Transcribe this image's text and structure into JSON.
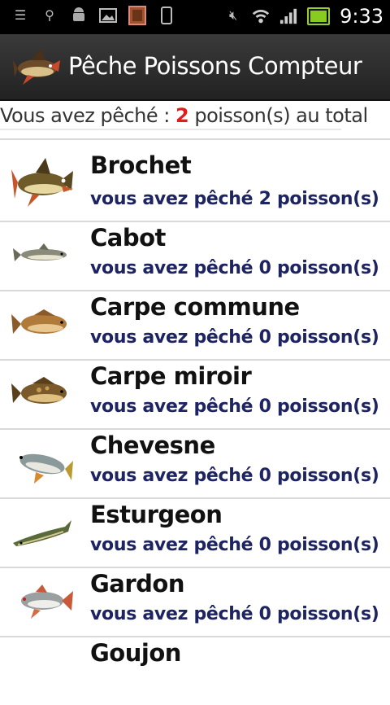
{
  "status_bar": {
    "time": "9:33",
    "icons": [
      "notification-icon",
      "usb-icon",
      "android-icon",
      "image-icon",
      "sd-card-icon",
      "phone-icon",
      "mute-icon",
      "wifi-icon",
      "signal-icon",
      "battery-icon"
    ]
  },
  "app": {
    "title": "Pêche Poissons Compteur",
    "icon": "fish-logo-icon"
  },
  "total": {
    "prefix": "Vous avez pêché : ",
    "count": "2",
    "suffix": " poisson(s) au total"
  },
  "colors": {
    "accent": "#e21b1b",
    "count_text": "#1e2462",
    "actionbar": "#2c2c2c"
  },
  "fish": [
    {
      "name": "Brochet",
      "count_text": "vous avez pêché 2 poisson(s)"
    },
    {
      "name": "Cabot",
      "count_text": "vous avez pêché 0 poisson(s)"
    },
    {
      "name": "Carpe commune",
      "count_text": "vous avez pêché 0 poisson(s)"
    },
    {
      "name": "Carpe miroir",
      "count_text": "vous avez pêché 0 poisson(s)"
    },
    {
      "name": "Chevesne",
      "count_text": "vous avez pêché 0 poisson(s)"
    },
    {
      "name": "Esturgeon",
      "count_text": "vous avez pêché 0 poisson(s)"
    },
    {
      "name": "Gardon",
      "count_text": "vous avez pêché 0 poisson(s)"
    },
    {
      "name": "Goujon",
      "count_text": ""
    }
  ]
}
